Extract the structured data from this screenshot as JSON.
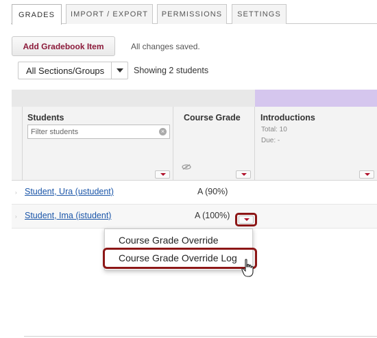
{
  "tabs": [
    {
      "label": "GRADES",
      "active": true
    },
    {
      "label": "IMPORT / EXPORT",
      "active": false
    },
    {
      "label": "PERMISSIONS",
      "active": false
    },
    {
      "label": "SETTINGS",
      "active": false
    }
  ],
  "toolbar": {
    "add_item_label": "Add Gradebook Item",
    "status_text": "All changes saved.",
    "section_filter_value": "All Sections/Groups",
    "showing_text": "Showing 2 students"
  },
  "grid": {
    "students_header": "Students",
    "filter_placeholder": "Filter students",
    "course_grade_header": "Course Grade",
    "assignment": {
      "title": "Introductions",
      "total": "Total: 10",
      "due": "Due: -"
    },
    "rows": [
      {
        "student": "Student, Ura (ustudent)",
        "grade": "A (90%)"
      },
      {
        "student": "Student, Ima (istudent)",
        "grade": "A (100%)"
      }
    ]
  },
  "context_menu": {
    "items": [
      "Course Grade Override",
      "Course Grade Override Log"
    ]
  },
  "colors": {
    "accent": "#8c1a3a",
    "highlight_outline": "#8c1616",
    "link": "#1a55a8",
    "category_band": "#d5c6ee"
  },
  "icons": [
    "clear-filter-icon",
    "chevron-down-icon",
    "hidden-eye-icon",
    "hand-pointer-cursor-icon",
    "row-drag-handle-icon"
  ]
}
